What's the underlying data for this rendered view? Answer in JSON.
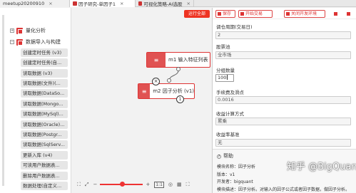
{
  "tabs": [
    {
      "label": "meetup20200910",
      "close": "×"
    },
    {
      "label": "因子研究-单因子1",
      "close": "×"
    },
    {
      "label": "可视化策略-AI选股",
      "close": "×"
    }
  ],
  "sidebar": {
    "groups": [
      {
        "toggle": "+",
        "label": "量化分析"
      },
      {
        "toggle": "−",
        "label": "数据导入与构建"
      }
    ],
    "items": [
      "创建定时任务 (v3)",
      "创建定时任务(自...",
      "读取数据 (v3)",
      "读取数据(文件)(...",
      "读取数据(DataSo...",
      "读取数据(Mongo...",
      "读取数据(MySql)...",
      "读取数据(Oracle)...",
      "读取数据(Postgr...",
      "读取数据(SqlServ...",
      "更新入库 (v4)",
      "可读用户数据表...",
      "删除用户数据表...",
      "数据处理(自定义..."
    ]
  },
  "canvas": {
    "run_button": "运行全部",
    "node1_label": "m1 输入特征列表",
    "node2_label": "m2 因子分析 (v1)",
    "x_button": "×",
    "port_number": "1",
    "node_icon": "≡",
    "zoom_out": "−",
    "zoom_in": "+",
    "zoom_ratio": "1:1",
    "zoom_level": 0.5
  },
  "panel": {
    "save": "保存",
    "start_trade": "开始交易",
    "close_env": "关闭开发环境",
    "fields": [
      {
        "label": "调仓周期(交易日)",
        "value": "2"
      },
      {
        "label": "股票池",
        "value": "全市场"
      },
      {
        "label": "分组数量",
        "value": "100"
      },
      {
        "label": "手续费及滑点",
        "value": "0.0016"
      },
      {
        "label": "收益计算方式",
        "value": "累乘"
      },
      {
        "label": "收益率基准",
        "value": "无"
      }
    ],
    "help": {
      "title": "帮助",
      "lines": [
        "模块名称：因子分析",
        "版本：v1",
        "开发者：bigquant",
        "模块描述：因子分析。对输入的因子公式或者因子数据，做因子分析。"
      ]
    },
    "watermark": "知乎 @BigQuant"
  },
  "colors": {
    "accent": "#e03333"
  }
}
